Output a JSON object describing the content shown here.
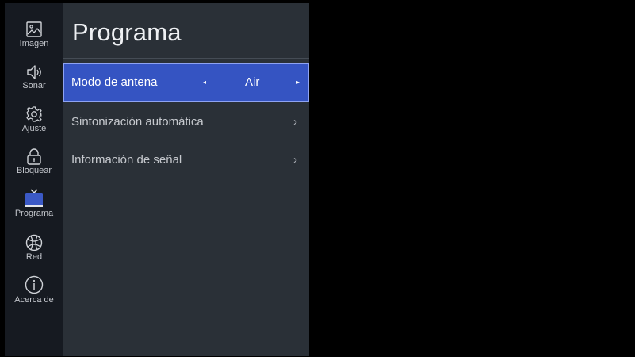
{
  "sidebar": {
    "items": [
      {
        "label": "Imagen",
        "icon": "image-icon"
      },
      {
        "label": "Sonar",
        "icon": "speaker-icon"
      },
      {
        "label": "Ajuste",
        "icon": "gear-icon"
      },
      {
        "label": "Bloquear",
        "icon": "lock-icon"
      },
      {
        "label": "Programa",
        "icon": "tv-icon"
      },
      {
        "label": "Red",
        "icon": "globe-icon"
      },
      {
        "label": "Acerca de",
        "icon": "info-icon"
      }
    ]
  },
  "panel": {
    "title": "Programa",
    "rows": [
      {
        "label": "Modo de antena",
        "value": "Air",
        "left_arrow": "◂",
        "right_arrow": "▸"
      },
      {
        "label": "Sintonización automática",
        "chevron": "›"
      },
      {
        "label": "Información de señal",
        "chevron": "›"
      }
    ]
  },
  "colors": {
    "accent": "#3554c2",
    "sidebar_bg": "#161a21",
    "panel_bg": "#2a3037",
    "screen_bg": "#000000"
  }
}
